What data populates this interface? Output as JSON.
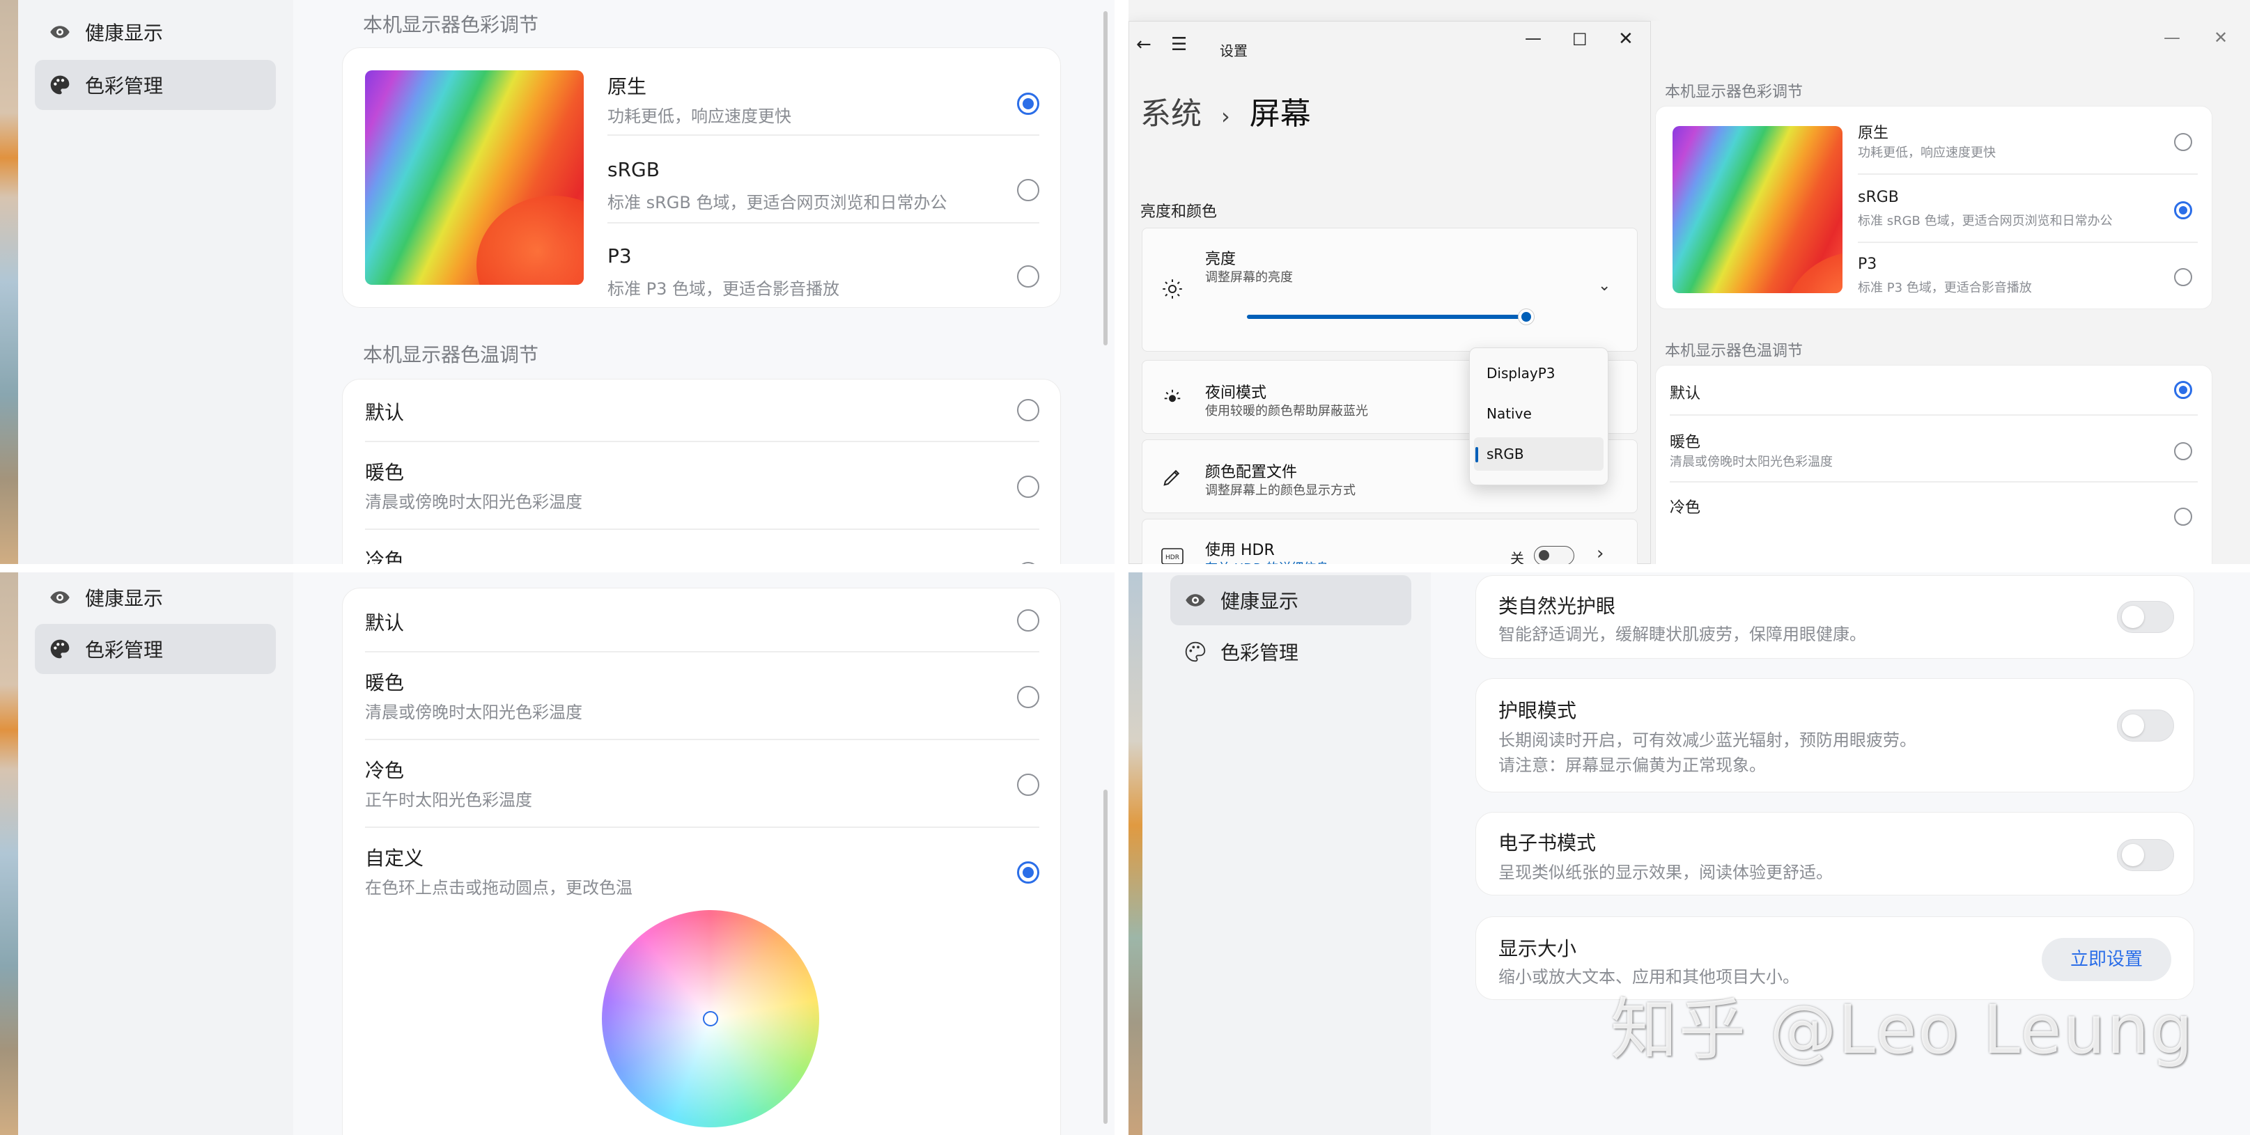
{
  "q1": {
    "nav": [
      {
        "label": "健康显示"
      },
      {
        "label": "色彩管理"
      }
    ],
    "gamut_title": "本机显示器色彩调节",
    "gamut": [
      {
        "title": "原生",
        "sub": "功耗更低，响应速度更快"
      },
      {
        "title": "sRGB",
        "sub": "标准 sRGB 色域，更适合网页浏览和日常办公"
      },
      {
        "title": "P3",
        "sub": "标准 P3 色域，更适合影音播放"
      }
    ],
    "temp_title": "本机显示器色温调节",
    "temp": [
      {
        "title": "默认",
        "sub": ""
      },
      {
        "title": "暖色",
        "sub": "清晨或傍晚时太阳光色彩温度"
      },
      {
        "title": "冷色",
        "sub": ""
      }
    ]
  },
  "q2": {
    "app_title": "设置",
    "crumb_parent": "系统",
    "crumb_sep": "›",
    "crumb_current": "屏幕",
    "section": "亮度和颜色",
    "brightness": {
      "title": "亮度",
      "sub": "调整屏幕的亮度",
      "level_percent": 97
    },
    "night": {
      "title": "夜间模式",
      "sub": "使用较暖的颜色帮助屏蔽蓝光"
    },
    "profile": {
      "title": "颜色配置文件",
      "sub": "调整屏幕上的颜色显示方式"
    },
    "hdr": {
      "title": "使用 HDR",
      "link": "有关 HDR 的详细信息",
      "state": "关"
    },
    "dropdown": [
      "DisplayP3",
      "Native",
      "sRGB"
    ],
    "dropdown_selected": "sRGB",
    "right": {
      "gamut_title": "本机显示器色彩调节",
      "gamut": [
        {
          "title": "原生",
          "sub": "功耗更低，响应速度更快"
        },
        {
          "title": "sRGB",
          "sub": "标准 sRGB 色域，更适合网页浏览和日常办公"
        },
        {
          "title": "P3",
          "sub": "标准 P3 色域，更适合影音播放"
        }
      ],
      "temp_title": "本机显示器色温调节",
      "temp": [
        {
          "title": "默认",
          "sub": ""
        },
        {
          "title": "暖色",
          "sub": "清晨或傍晚时太阳光色彩温度"
        },
        {
          "title": "冷色",
          "sub": ""
        }
      ]
    }
  },
  "q3": {
    "nav": [
      {
        "label": "健康显示"
      },
      {
        "label": "色彩管理"
      }
    ],
    "temp": [
      {
        "title": "默认",
        "sub": ""
      },
      {
        "title": "暖色",
        "sub": "清晨或傍晚时太阳光色彩温度"
      },
      {
        "title": "冷色",
        "sub": "正午时太阳光色彩温度"
      },
      {
        "title": "自定义",
        "sub": "在色环上点击或拖动圆点，更改色温"
      }
    ]
  },
  "q4": {
    "nav": [
      {
        "label": "健康显示"
      },
      {
        "label": "色彩管理"
      }
    ],
    "items": [
      {
        "title": "类自然光护眼",
        "sub": "智能舒适调光，缓解睫状肌疲劳，保障用眼健康。"
      },
      {
        "title": "护眼模式",
        "sub": "长期阅读时开启，可有效减少蓝光辐射，预防用眼疲劳。",
        "sub2": "请注意：屏幕显示偏黄为正常现象。"
      },
      {
        "title": "电子书模式",
        "sub": "呈现类似纸张的显示效果，阅读体验更舒适。"
      },
      {
        "title": "显示大小",
        "sub": "缩小或放大文本、应用和其他项目大小。",
        "button": "立即设置"
      }
    ],
    "watermark": "知乎 @Leo Leung"
  },
  "colors": {
    "accent": "#2b6ee8",
    "win_accent": "#005fb8"
  }
}
